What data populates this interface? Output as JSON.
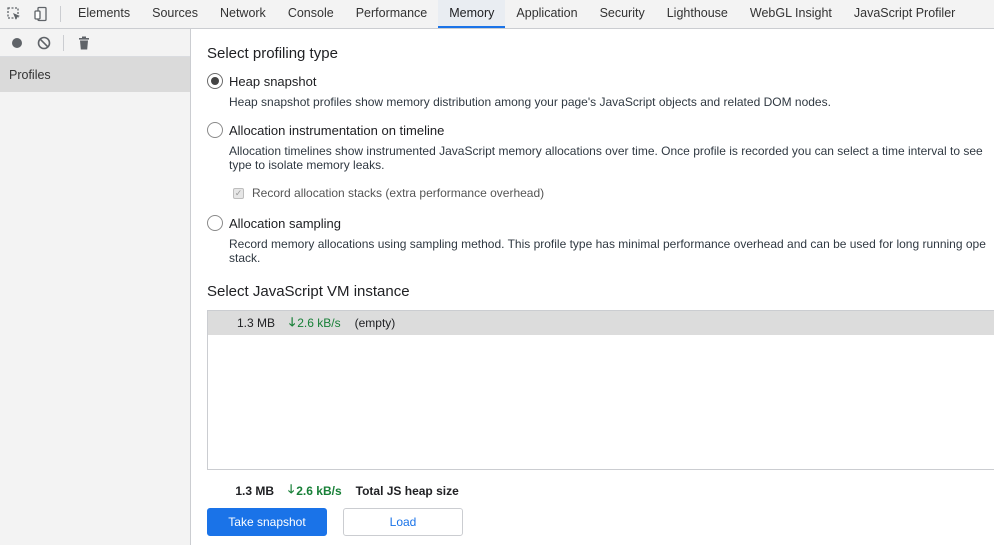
{
  "tabs": [
    "Elements",
    "Sources",
    "Network",
    "Console",
    "Performance",
    "Memory",
    "Application",
    "Security",
    "Lighthouse",
    "WebGL Insight",
    "JavaScript Profiler"
  ],
  "active_tab": "Memory",
  "sidebar": {
    "profiles_label": "Profiles"
  },
  "profiling": {
    "heading": "Select profiling type",
    "options": [
      {
        "label": "Heap snapshot",
        "desc": "Heap snapshot profiles show memory distribution among your page's JavaScript objects and related DOM nodes.",
        "checked": true
      },
      {
        "label": "Allocation instrumentation on timeline",
        "desc1": "Allocation timelines show instrumented JavaScript memory allocations over time. Once profile is recorded you can select a time interval to see",
        "desc2": "type to isolate memory leaks."
      },
      {
        "label": "Allocation sampling",
        "desc1": "Record memory allocations using sampling method. This profile type has minimal performance overhead and can be used for long running ope",
        "desc2": "stack."
      }
    ],
    "record_stacks_label": "Record allocation stacks (extra performance overhead)"
  },
  "vm": {
    "heading": "Select JavaScript VM instance",
    "rows": [
      {
        "size": "1.3 MB",
        "rate": "2.6 kB/s",
        "name": "(empty)"
      }
    ],
    "summary": {
      "size": "1.3 MB",
      "rate": "2.6 kB/s",
      "label": "Total JS heap size"
    }
  },
  "buttons": {
    "take_snapshot": "Take snapshot",
    "load": "Load"
  },
  "colors": {
    "accent": "#1a73e8",
    "rate": "#188038"
  }
}
